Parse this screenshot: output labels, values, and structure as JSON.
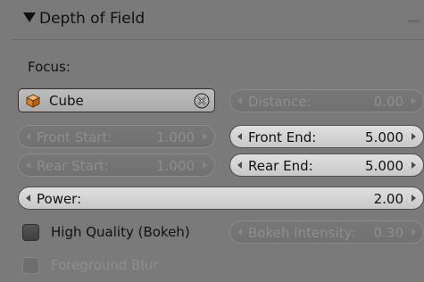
{
  "panel": {
    "title": "Depth of Field",
    "focus_label": "Focus:",
    "focus_object": "Cube",
    "distance": {
      "label": "Distance:",
      "value": "0.00"
    },
    "front_start": {
      "label": "Front Start:",
      "value": "1.000"
    },
    "front_end": {
      "label": "Front End:",
      "value": "5.000"
    },
    "rear_start": {
      "label": "Rear Start:",
      "value": "1.000"
    },
    "rear_end": {
      "label": "Rear End:",
      "value": "5.000"
    },
    "power": {
      "label": "Power:",
      "value": "2.00"
    },
    "high_quality": {
      "label": "High Quality (Bokeh)",
      "checked": false
    },
    "bokeh_intensity": {
      "label": "Bokeh Intensity:",
      "value": "0.30"
    },
    "foreground_blur": {
      "label": "Foreground Blur",
      "checked": false
    }
  },
  "colors": {
    "panel_bg": "#737373",
    "active_field": "#d6d6d6",
    "disabled_text": "#8e8e8e",
    "cube_icon": "#e08a2a"
  },
  "icons": {
    "collapse": "triangle-down-icon",
    "drag": "drag-grip-icon",
    "object": "cube-icon",
    "clear": "x-icon"
  }
}
